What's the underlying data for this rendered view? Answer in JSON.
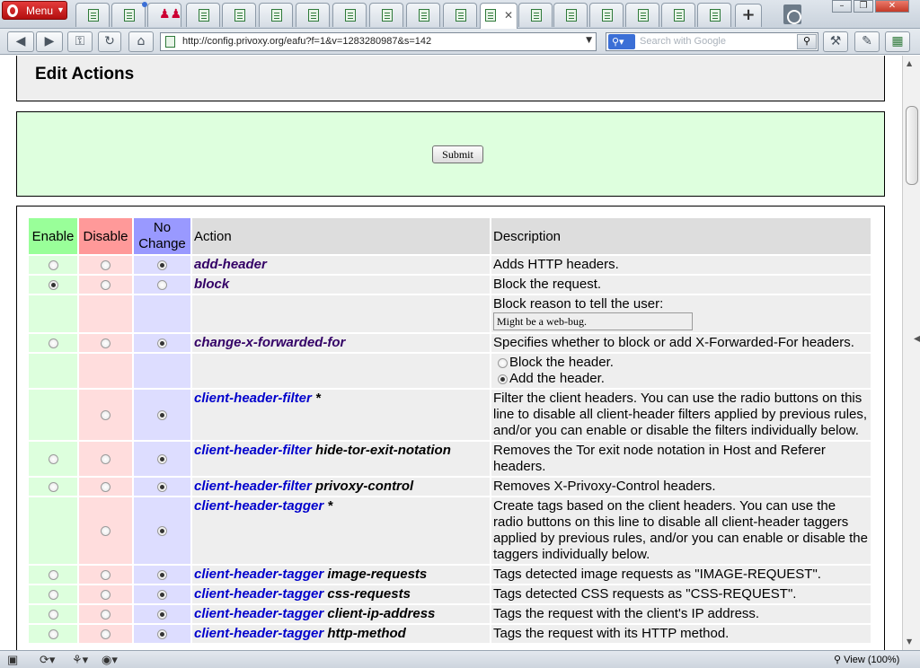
{
  "browser": {
    "menu_label": "Menu",
    "tab_close_glyph": "✕",
    "new_tab_glyph": "+",
    "address_url": "http://config.privoxy.org/eafu?f=1&v=1283280987&s=142",
    "search_placeholder": "Search with Google",
    "zoom_label": "View (100%)"
  },
  "page": {
    "title": "Edit Actions",
    "submit_label": "Submit",
    "headers": {
      "enable": "Enable",
      "disable": "Disable",
      "no_change": "No Change",
      "action": "Action",
      "description": "Description"
    },
    "rows": {
      "add_header": {
        "name": "add-header",
        "desc": "Adds HTTP headers."
      },
      "block": {
        "name": "block",
        "desc": "Block the request."
      },
      "block_reason": {
        "label": "Block reason to tell the user:",
        "value": "Might be a web-bug."
      },
      "xff": {
        "name": "change-x-forwarded-for",
        "desc": "Specifies whether to block or add X-Forwarded-For headers."
      },
      "xff_options": {
        "block": "Block the header.",
        "add": "Add the header."
      },
      "chf_all": {
        "name": "client-header-filter",
        "param": "*",
        "desc": "Filter the client headers. You can use the radio buttons on this line to disable all client-header filters applied by previous rules, and/or you can enable or disable the filters individually below."
      },
      "chf_tor": {
        "name": "client-header-filter",
        "param": "hide-tor-exit-notation",
        "desc": "Removes the Tor exit node notation in Host and Referer headers."
      },
      "chf_privoxy": {
        "name": "client-header-filter",
        "param": "privoxy-control",
        "desc": "Removes X-Privoxy-Control headers."
      },
      "cht_all": {
        "name": "client-header-tagger",
        "param": "*",
        "desc": "Create tags based on the client headers. You can use the radio buttons on this line to disable all client-header taggers applied by previous rules, and/or you can enable or disable the taggers individually below."
      },
      "cht_image": {
        "name": "client-header-tagger",
        "param": "image-requests",
        "desc": "Tags detected image requests as \"IMAGE-REQUEST\"."
      },
      "cht_css": {
        "name": "client-header-tagger",
        "param": "css-requests",
        "desc": "Tags detected CSS requests as \"CSS-REQUEST\"."
      },
      "cht_ip": {
        "name": "client-header-tagger",
        "param": "client-ip-address",
        "desc": "Tags the request with the client's IP address."
      },
      "cht_method": {
        "name": "client-header-tagger",
        "param": "http-method",
        "desc": "Tags the request with its HTTP method."
      }
    }
  }
}
